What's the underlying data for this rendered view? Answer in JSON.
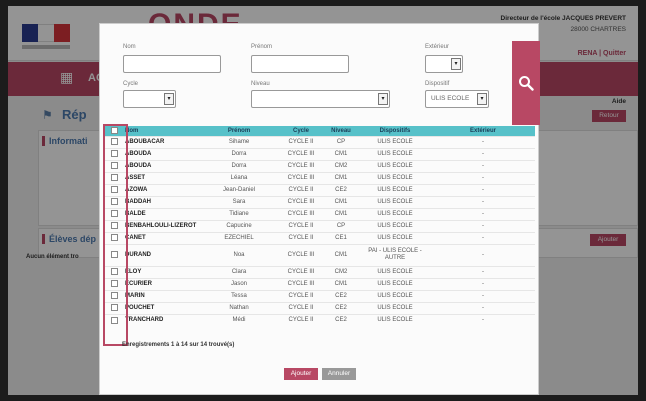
{
  "background": {
    "app_name": "ONDE",
    "director_label": "Directeur de l'école JACQUES PREVERT",
    "city": "28000 CHARTRES",
    "user_links": "RENA | Quitter",
    "nav_text": "AC",
    "page_title": "Rép",
    "aide": "Aide",
    "retour": "Retour",
    "info_title": "Informati",
    "eleves_title": "Élèves dép",
    "ajouter": "Ajouter",
    "aucun": "Aucun élément tro"
  },
  "search": {
    "nom_label": "Nom",
    "prenom_label": "Prénom",
    "exterieur_label": "Extérieur",
    "cycle_label": "Cycle",
    "niveau_label": "Niveau",
    "dispositif_label": "Dispositif",
    "dispositif_value": "ULIS ECOLE",
    "nom_value": "",
    "prenom_value": "",
    "cycle_value": "",
    "niveau_value": "",
    "exterieur_value": ""
  },
  "table": {
    "headers": [
      "Nom",
      "Prénom",
      "Cycle",
      "Niveau",
      "Dispositifs",
      "Extérieur"
    ],
    "rows": [
      {
        "nom": "ABOUBACAR",
        "prenom": "Sihame",
        "cycle": "CYCLE II",
        "niveau": "CP",
        "dispositif": "ULIS ECOLE",
        "exterieur": "-"
      },
      {
        "nom": "ABOUDA",
        "prenom": "Dorra",
        "cycle": "CYCLE III",
        "niveau": "CM1",
        "dispositif": "ULIS ECOLE",
        "exterieur": "-"
      },
      {
        "nom": "ABOUDA",
        "prenom": "Dorra",
        "cycle": "CYCLE III",
        "niveau": "CM2",
        "dispositif": "ULIS ECOLE",
        "exterieur": "-"
      },
      {
        "nom": "ASSET",
        "prenom": "Léana",
        "cycle": "CYCLE III",
        "niveau": "CM1",
        "dispositif": "ULIS ECOLE",
        "exterieur": "-"
      },
      {
        "nom": "AZOWA",
        "prenom": "Jean-Daniel",
        "cycle": "CYCLE II",
        "niveau": "CE2",
        "dispositif": "ULIS ECOLE",
        "exterieur": "-"
      },
      {
        "nom": "BADDAH",
        "prenom": "Sara",
        "cycle": "CYCLE III",
        "niveau": "CM1",
        "dispositif": "ULIS ECOLE",
        "exterieur": "-"
      },
      {
        "nom": "BALDE",
        "prenom": "Tidiane",
        "cycle": "CYCLE III",
        "niveau": "CM1",
        "dispositif": "ULIS ECOLE",
        "exterieur": "-"
      },
      {
        "nom": "BENBAHLOULI-LIZEROT",
        "prenom": "Capucine",
        "cycle": "CYCLE II",
        "niveau": "CP",
        "dispositif": "ULIS ECOLE",
        "exterieur": "-"
      },
      {
        "nom": "CANET",
        "prenom": "EZECHIEL",
        "cycle": "CYCLE II",
        "niveau": "CE1",
        "dispositif": "ULIS ECOLE",
        "exterieur": "-"
      },
      {
        "nom": "DURAND",
        "prenom": "Noa",
        "cycle": "CYCLE III",
        "niveau": "CM1",
        "dispositif": "PAI - ULIS ECOLE - AUTRE",
        "exterieur": "-"
      },
      {
        "nom": "ELOY",
        "prenom": "Clara",
        "cycle": "CYCLE III",
        "niveau": "CM2",
        "dispositif": "ULIS ECOLE",
        "exterieur": "-"
      },
      {
        "nom": "ECURIER",
        "prenom": "Jason",
        "cycle": "CYCLE III",
        "niveau": "CM1",
        "dispositif": "ULIS ECOLE",
        "exterieur": "-"
      },
      {
        "nom": "MARIN",
        "prenom": "Tessa",
        "cycle": "CYCLE II",
        "niveau": "CE2",
        "dispositif": "ULIS ECOLE",
        "exterieur": "-"
      },
      {
        "nom": "POUCHET",
        "prenom": "Nathan",
        "cycle": "CYCLE II",
        "niveau": "CE2",
        "dispositif": "ULIS ECOLE",
        "exterieur": "-"
      },
      {
        "nom": "TRANCHARD",
        "prenom": "Médi",
        "cycle": "CYCLE II",
        "niveau": "CE2",
        "dispositif": "ULIS ECOLE",
        "exterieur": "-"
      }
    ],
    "footer": "Enregistrements 1 à 14 sur 14 trouvé(s)"
  },
  "buttons": {
    "ajouter": "Ajouter",
    "annuler": "Annuler"
  },
  "colors": {
    "accent": "#b84864",
    "table_header": "#57c1c9",
    "title_blue": "#4d7ab0"
  }
}
